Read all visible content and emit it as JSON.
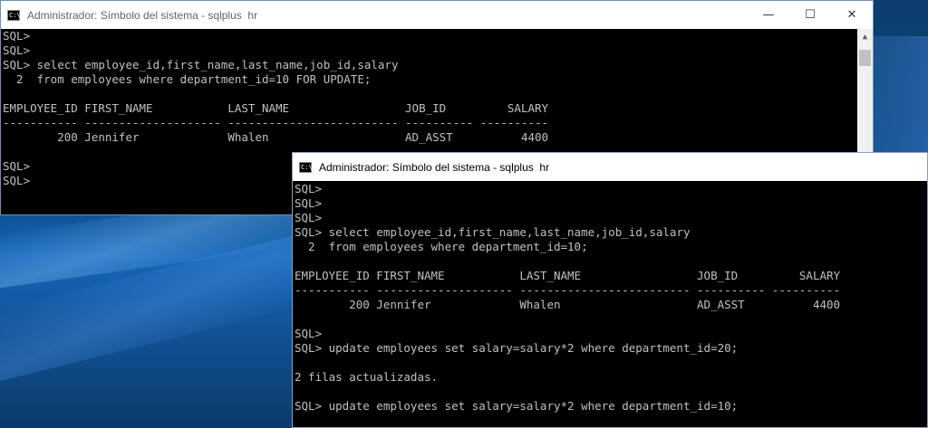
{
  "win1": {
    "title": "Administrador: Símbolo del sistema - sqlplus  hr",
    "lines": [
      "SQL>",
      "SQL>",
      "SQL> select employee_id,first_name,last_name,job_id,salary",
      "  2  from employees where department_id=10 FOR UPDATE;",
      "",
      "EMPLOYEE_ID FIRST_NAME           LAST_NAME                 JOB_ID         SALARY",
      "----------- -------------------- ------------------------- ---------- ----------",
      "        200 Jennifer             Whalen                    AD_ASST          4400",
      "",
      "SQL>",
      "SQL>"
    ]
  },
  "win2": {
    "title": "Administrador: Símbolo del sistema - sqlplus  hr",
    "lines": [
      "SQL>",
      "SQL>",
      "SQL>",
      "SQL> select employee_id,first_name,last_name,job_id,salary",
      "  2  from employees where department_id=10;",
      "",
      "EMPLOYEE_ID FIRST_NAME           LAST_NAME                 JOB_ID         SALARY",
      "----------- -------------------- ------------------------- ---------- ----------",
      "        200 Jennifer             Whalen                    AD_ASST          4400",
      "",
      "SQL>",
      "SQL> update employees set salary=salary*2 where department_id=20;",
      "",
      "2 filas actualizadas.",
      "",
      "SQL> update employees set salary=salary*2 where department_id=10;"
    ]
  },
  "icons": {
    "cmd": "cmd-icon",
    "minimize": "minimize-icon",
    "maximize": "maximize-icon",
    "close": "close-icon",
    "scroll_up": "scroll-up-arrow-icon"
  },
  "caption_glyphs": {
    "minimize": "—",
    "maximize": "☐",
    "close": "✕",
    "scroll_up": "▲"
  },
  "colors": {
    "console_bg": "#000000",
    "console_text": "#c0c0c0",
    "titlebar_bg": "#ffffff"
  }
}
